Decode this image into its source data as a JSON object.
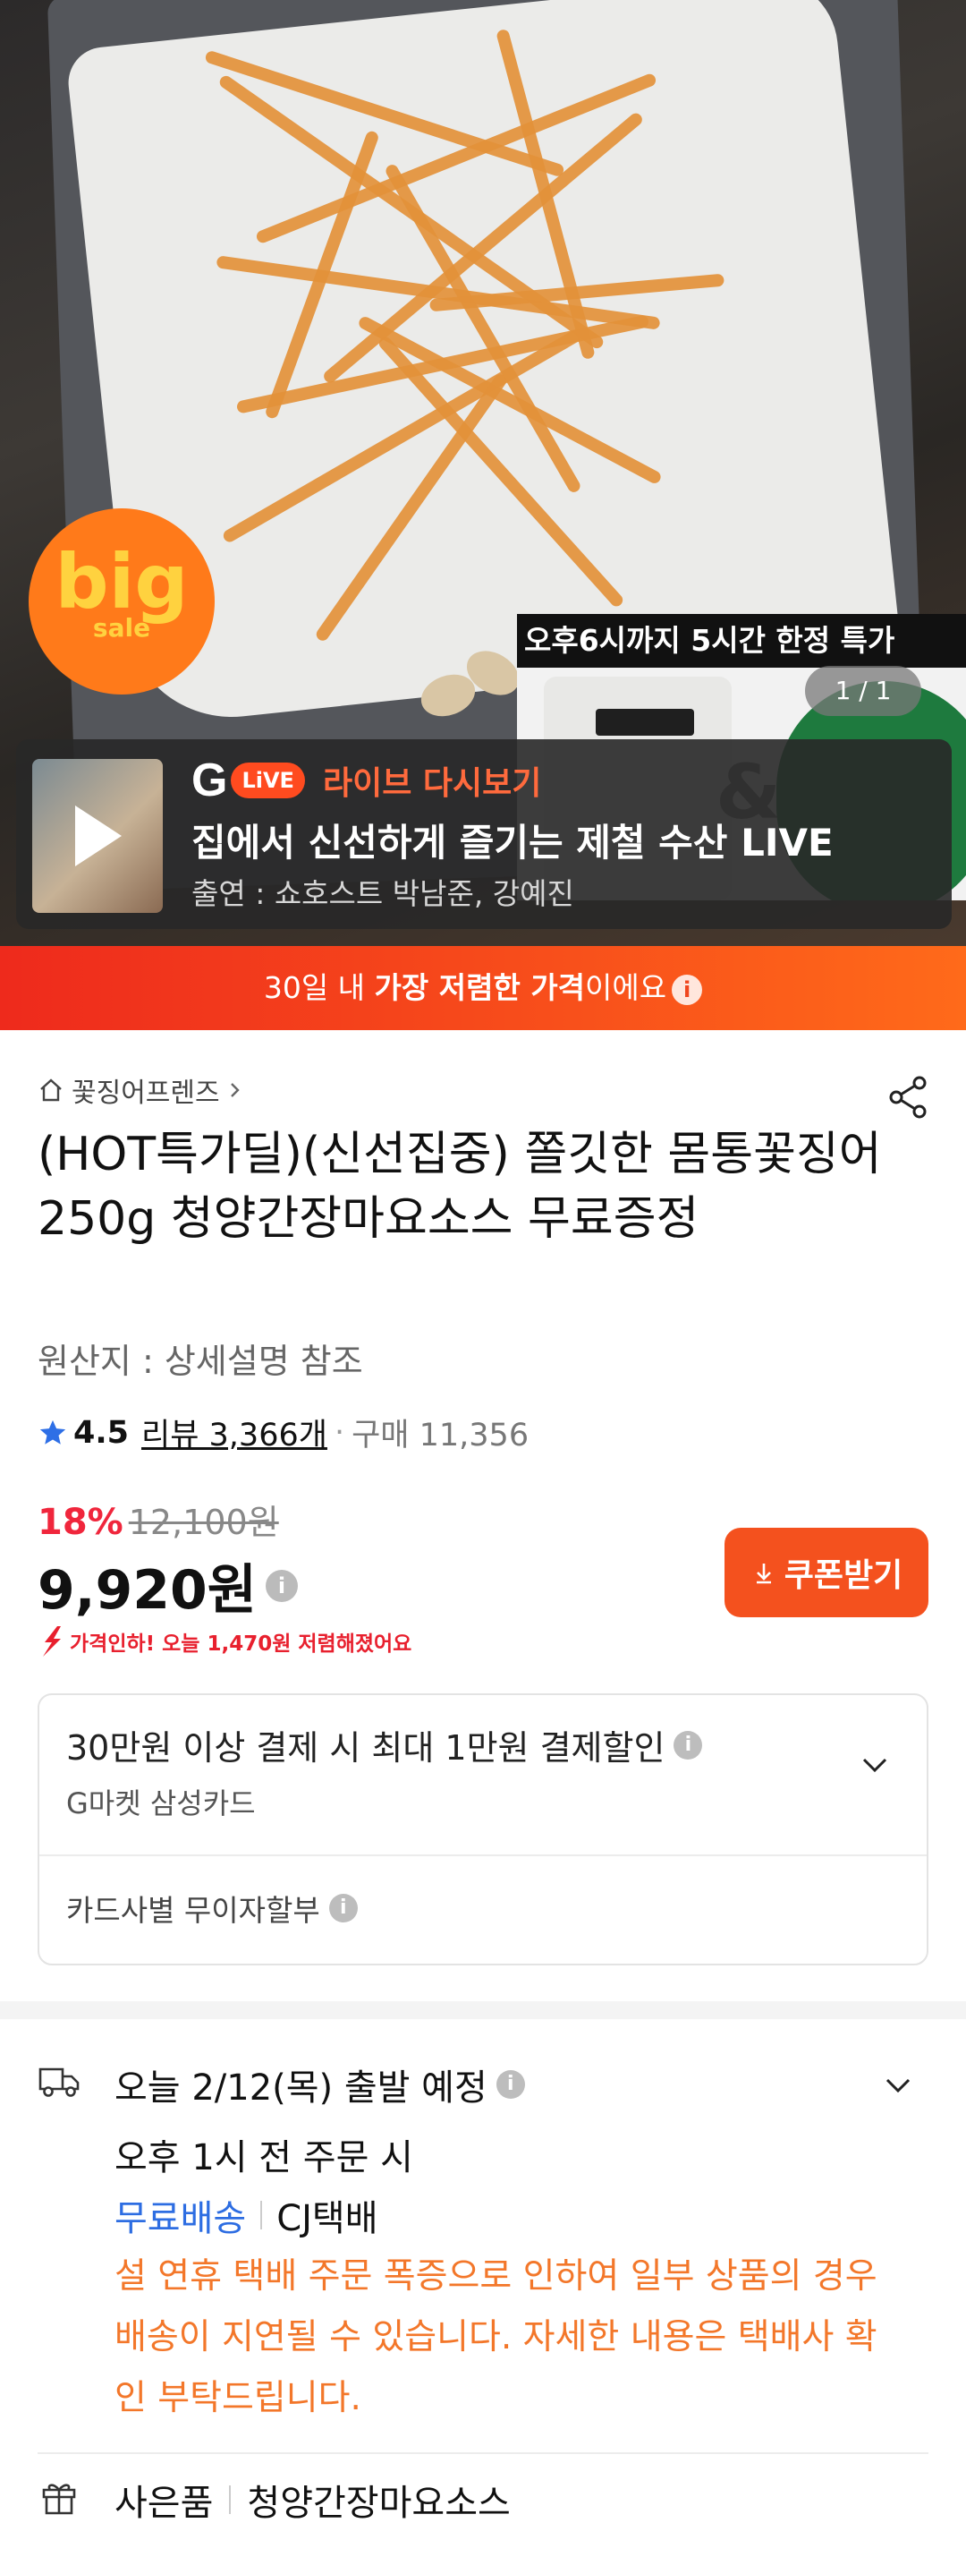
{
  "hero": {
    "badge": {
      "big": "big",
      "sale": "sale"
    },
    "deal_banner": "오후6시까지 5시간 한정 특가",
    "slide_counter": "1 / 1",
    "live": {
      "logo": "G",
      "pill": "LiVE",
      "kind": "라이브 다시보기",
      "title": "집에서 신선하게 즐기는 제철 수산 LIVE",
      "cast": "출연 : 쇼호스트 박남준, 강예진"
    }
  },
  "price_banner": {
    "pre": "30일 내 ",
    "strong": "가장 저렴한 가격",
    "post": "이에요"
  },
  "product": {
    "shop": "꽃징어프렌즈",
    "title": "(HOT특가딜)(신선집중) 쫄깃한 몸통꽃징어 250g 청양간장마요소스 무료증정",
    "origin": "원산지 : 상세설명 참조",
    "rating": {
      "score": "4.5",
      "reviews": "리뷰 3,366개",
      "sep": "·",
      "purchases": "구매 11,356"
    },
    "discount_pct": "18%",
    "original_price": "12,100원",
    "price": "9,920원",
    "coupon_label": "쿠폰받기",
    "price_drop": "가격인하! 오늘 1,470원 저렴해졌어요"
  },
  "card_benefit": {
    "title": "30만원 이상 결제 시 최대 1만원 결제할인",
    "sub": "G마켓 삼성카드",
    "installment": "카드사별 무이자할부"
  },
  "shipping": {
    "departure": "오늘 2/12(목) 출발 예정",
    "cutoff": "오후 1시  전 주문 시",
    "free": "무료배송",
    "carrier": "CJ택배",
    "notice": "설 연휴 택배 주문 폭증으로 인하여 일부 상품의 경우 배송이 지연될 수 있습니다. 자세한 내용은 택배사 확인 부탁드립니다."
  },
  "gift": {
    "label": "사은품",
    "value": "청양간장마요소스"
  },
  "colors": {
    "accent": "#f4511e",
    "discount": "#f0263c",
    "notice": "#f3772a",
    "free_shipping": "#2d6de2",
    "star": "#2e6fe6"
  }
}
